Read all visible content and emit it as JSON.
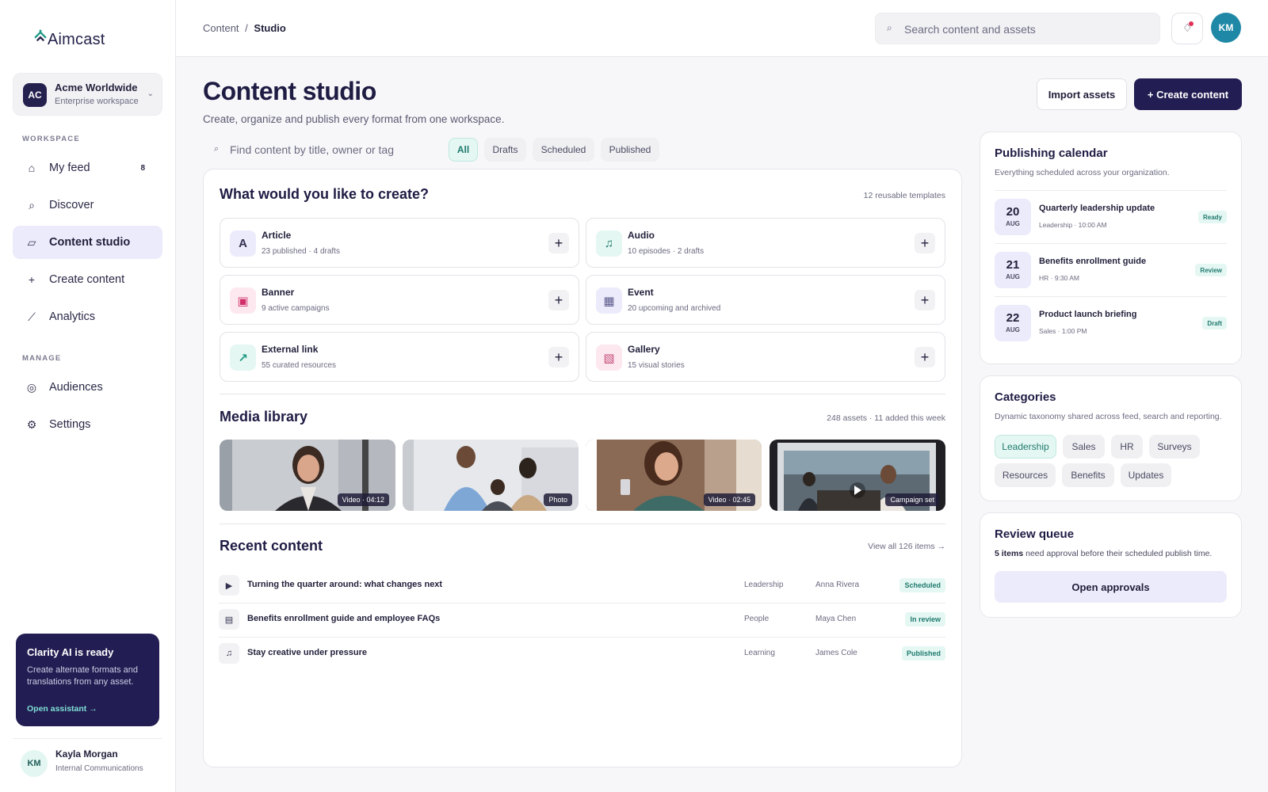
{
  "brand": {
    "name": "Aimcast"
  },
  "workspace": {
    "initials": "AC",
    "name": "Acme Worldwide",
    "plan": "Enterprise workspace"
  },
  "sidebar": {
    "workspace_label": "WORKSPACE",
    "manage_label": "MANAGE",
    "items": [
      {
        "label": "My feed",
        "icon": "home-icon",
        "count": "8"
      },
      {
        "label": "Discover",
        "icon": "search-icon"
      },
      {
        "label": "Content studio",
        "icon": "studio-icon",
        "active": true
      },
      {
        "label": "Create content",
        "icon": "plus-icon"
      },
      {
        "label": "Analytics",
        "icon": "analytics-icon"
      }
    ],
    "manage_items": [
      {
        "label": "Audiences",
        "icon": "audiences-icon"
      },
      {
        "label": "Settings",
        "icon": "gear-icon"
      }
    ]
  },
  "ai_card": {
    "title": "Clarity AI is ready",
    "text": "Create alternate formats and translations from any asset.",
    "link": "Open assistant →"
  },
  "user": {
    "initials": "KM",
    "name": "Kayla Morgan",
    "role": "Internal Communications"
  },
  "topbar": {
    "breadcrumb_root": "Content",
    "breadcrumb_sep": "/",
    "breadcrumb_current": "Studio",
    "search_placeholder": "Search content and assets",
    "avatar_initials": "KM"
  },
  "header": {
    "title": "Content studio",
    "subtitle": "Create, organize and publish every format from one workspace.",
    "import_label": "Import assets",
    "create_label": "+ Create content"
  },
  "filters": {
    "search_placeholder": "Find content by title, owner or tag",
    "chips": [
      "All",
      "Drafts",
      "Scheduled",
      "Published"
    ]
  },
  "create": {
    "title": "What would you like to create?",
    "meta": "12 reusable templates",
    "types": [
      {
        "name": "Article",
        "sub": "23 published · 4 drafts",
        "glyph": "A"
      },
      {
        "name": "Audio",
        "sub": "10 episodes · 2 drafts",
        "glyph": "♫"
      },
      {
        "name": "Banner",
        "sub": "9 active campaigns",
        "glyph": "▣"
      },
      {
        "name": "Event",
        "sub": "20 upcoming and archived",
        "glyph": "▦"
      },
      {
        "name": "External link",
        "sub": "55 curated resources",
        "glyph": "↗"
      },
      {
        "name": "Gallery",
        "sub": "15 visual stories",
        "glyph": "▧"
      }
    ]
  },
  "media": {
    "title": "Media library",
    "meta": "248 assets · 11 added this week",
    "items": [
      {
        "badge": "Video · 04:12"
      },
      {
        "badge": "Photo"
      },
      {
        "badge": "Video · 02:45"
      },
      {
        "badge": "Campaign set"
      }
    ]
  },
  "recent": {
    "title": "Recent content",
    "view_all": "View all 126 items →",
    "rows": [
      {
        "icon": "▶",
        "title": "Turning the quarter around: what changes next",
        "category": "Leadership",
        "owner": "Anna Rivera",
        "status": "Scheduled"
      },
      {
        "icon": "▤",
        "title": "Benefits enrollment guide and employee FAQs",
        "category": "People",
        "owner": "Maya Chen",
        "status": "In review"
      },
      {
        "icon": "♫",
        "title": "Stay creative under pressure",
        "category": "Learning",
        "owner": "James Cole",
        "status": "Published"
      }
    ]
  },
  "calendar": {
    "title": "Publishing calendar",
    "sub": "Everything scheduled across your organization.",
    "items": [
      {
        "day": "20",
        "month": "AUG",
        "title": "Quarterly leadership update",
        "meta": "Leadership · 10:00 AM",
        "status": "Ready"
      },
      {
        "day": "21",
        "month": "AUG",
        "title": "Benefits enrollment guide",
        "meta": "HR · 9:30 AM",
        "status": "Review"
      },
      {
        "day": "22",
        "month": "AUG",
        "title": "Product launch briefing",
        "meta": "Sales · 1:00 PM",
        "status": "Draft"
      }
    ]
  },
  "categories": {
    "title": "Categories",
    "sub": "Dynamic taxonomy shared across feed, search and reporting.",
    "chips": [
      "Leadership",
      "Sales",
      "HR",
      "Surveys",
      "Resources",
      "Benefits",
      "Updates"
    ]
  },
  "review": {
    "title": "Review queue",
    "count_text": "5 items",
    "text": " need approval before their scheduled publish time.",
    "button": "Open approvals"
  },
  "colors": {
    "primary": "#221d52",
    "accent": "#1f7a6e",
    "accent_bg": "#e5f7f3"
  }
}
